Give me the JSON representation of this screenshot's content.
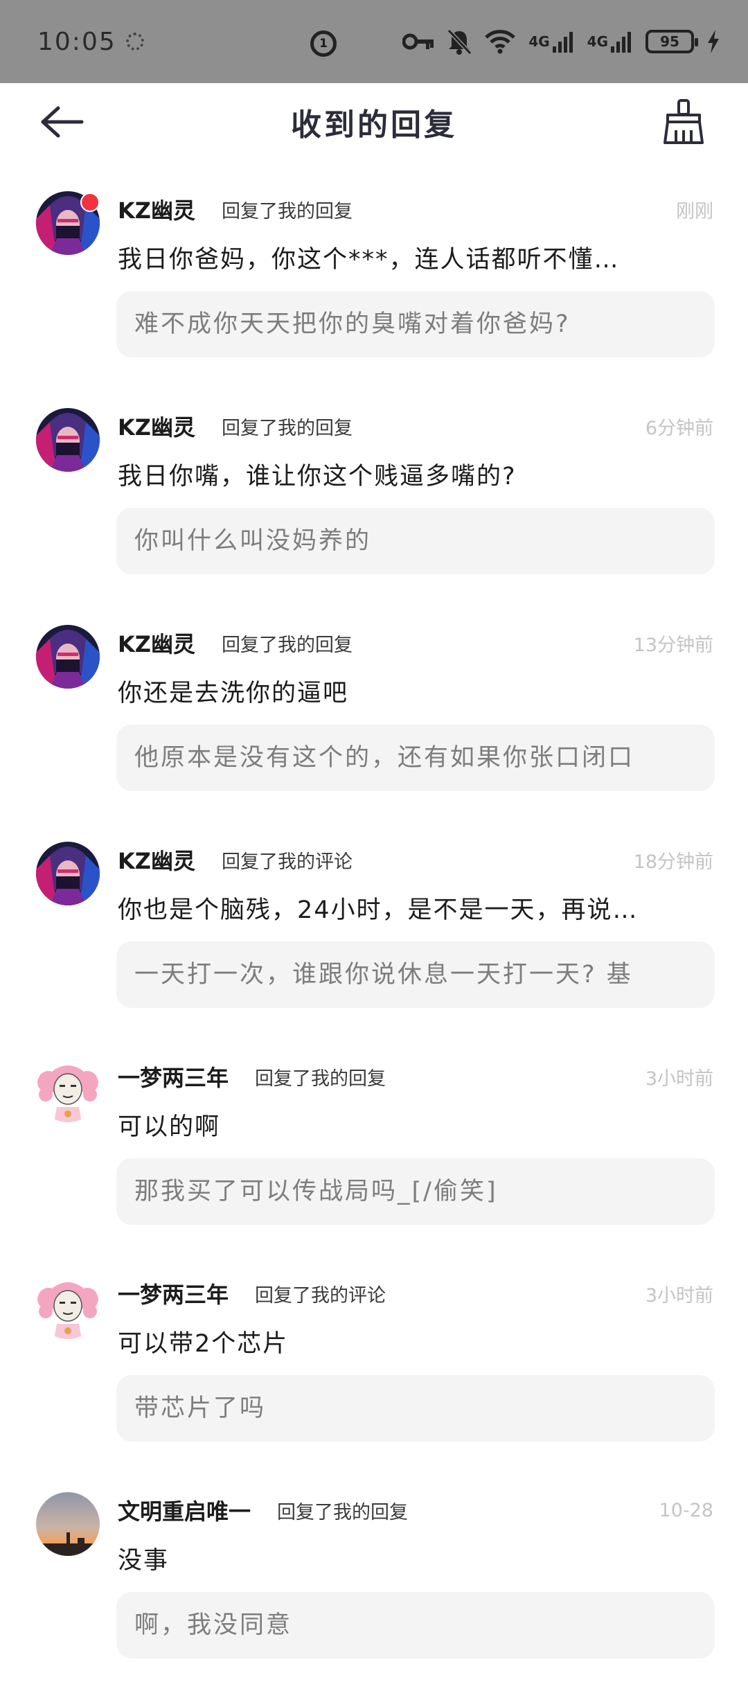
{
  "status_bar": {
    "time": "10:05",
    "center_badge": "1",
    "network_1": "4G",
    "network_2": "4G",
    "battery": "95",
    "icons": [
      "sync-icon",
      "notification-badge-icon",
      "key-icon",
      "bell-off-icon",
      "wifi-icon",
      "signal-icon",
      "signal-icon",
      "battery-icon",
      "charging-icon"
    ]
  },
  "header": {
    "title": "收到的回复",
    "back_icon": "arrow-left-icon",
    "clean_icon": "broom-icon"
  },
  "replies": [
    {
      "user": "KZ幽灵",
      "action": "回复了我的回复",
      "time": "刚刚",
      "content": "我日你爸妈，你这个***，连人话都听不懂…",
      "quote": "难不成你天天把你的臭嘴对着你爸妈?",
      "avatar": "masked-avatar",
      "unread": true
    },
    {
      "user": "KZ幽灵",
      "action": "回复了我的回复",
      "time": "6分钟前",
      "content": "我日你嘴，谁让你这个贱逼多嘴的?",
      "quote": "你叫什么叫没妈养的",
      "avatar": "masked-avatar",
      "unread": false
    },
    {
      "user": "KZ幽灵",
      "action": "回复了我的回复",
      "time": "13分钟前",
      "content": "你还是去洗你的逼吧",
      "quote": "他原本是没有这个的，还有如果你张口闭口",
      "avatar": "masked-avatar",
      "unread": false
    },
    {
      "user": "KZ幽灵",
      "action": "回复了我的评论",
      "time": "18分钟前",
      "content": "你也是个脑残，24小时，是不是一天，再说…",
      "quote": "一天打一次，谁跟你说休息一天打一天? 基",
      "avatar": "masked-avatar",
      "unread": false
    },
    {
      "user": "一梦两三年",
      "action": "回复了我的回复",
      "time": "3小时前",
      "content": "可以的啊",
      "quote": "那我买了可以传战局吗_[/偷笑]",
      "avatar": "pink-hair-avatar",
      "unread": false
    },
    {
      "user": "一梦两三年",
      "action": "回复了我的评论",
      "time": "3小时前",
      "content": "可以带2个芯片",
      "quote": "带芯片了吗",
      "avatar": "pink-hair-avatar",
      "unread": false
    },
    {
      "user": "文明重启唯一",
      "action": "回复了我的回复",
      "time": "10-28",
      "content": "没事",
      "quote": "啊，我没同意",
      "avatar": "sunset-avatar",
      "unread": false
    }
  ],
  "colors": {
    "status_bar_bg": "#8f8f8f",
    "quote_bg": "#f4f4f5",
    "unread_dot": "#f0333e",
    "time_text": "#c4c4c4"
  }
}
